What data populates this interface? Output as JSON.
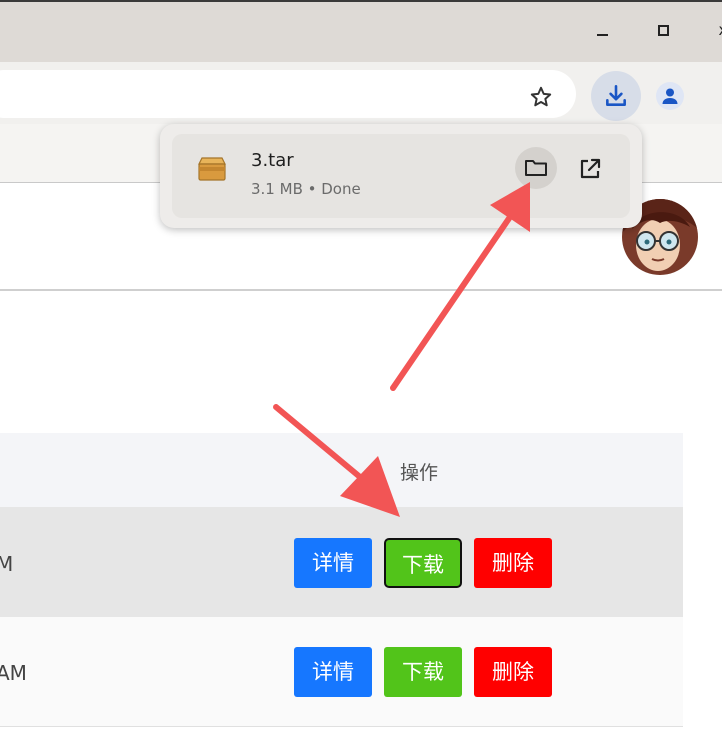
{
  "window": {
    "minimize_icon": "minimize-icon",
    "maximize_icon": "maximize-icon",
    "close_label": "x"
  },
  "toolbar": {
    "bookmark_icon": "star-icon",
    "download_icon": "download-icon",
    "profile_icon": "person-icon"
  },
  "download_bubble": {
    "file_name": "3.tar",
    "status": "3.1 MB • Done",
    "file_icon": "package-icon",
    "actions": [
      "show-in-folder-icon",
      "open-external-icon"
    ]
  },
  "table": {
    "ops_header": "操作",
    "rows": [
      {
        "time_fragment": "M",
        "buttons": [
          "详情",
          "下载",
          "删除"
        ]
      },
      {
        "time_fragment": "AM",
        "buttons": [
          "详情",
          "下载",
          "删除"
        ]
      }
    ]
  },
  "colors": {
    "detail": "#1677ff",
    "download": "#52c41a",
    "delete": "#ff0000",
    "annotation_arrow": "#f25555"
  }
}
